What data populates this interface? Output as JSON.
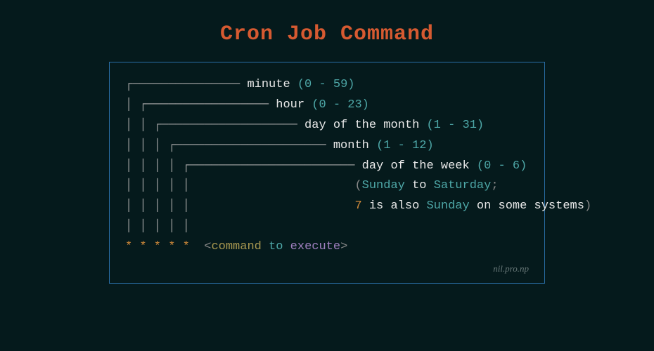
{
  "title": "Cron Job Command",
  "fields": {
    "f1": {
      "label": "minute",
      "range": "(0 - 59)"
    },
    "f2": {
      "label": "hour",
      "range": "(0 - 23)"
    },
    "f3": {
      "label": "day of the month",
      "range": "(1 - 31)"
    },
    "f4": {
      "label": "month",
      "range": "(1 - 12)"
    },
    "f5": {
      "label": "day of the week",
      "range": "(0 - 6)"
    }
  },
  "note": {
    "open": "(",
    "day1": "Sunday",
    "to": " to ",
    "day2": "Saturday",
    "semi": ";",
    "num": "7",
    "mid": " is also ",
    "day3": "Sunday",
    "tail": " on some systems",
    "close": ")"
  },
  "expression": {
    "stars": "* * * * *",
    "open": "<",
    "w1": "command",
    "w2": " to ",
    "w3": "execute",
    "close": ">"
  },
  "credit": "nil.pro.np"
}
